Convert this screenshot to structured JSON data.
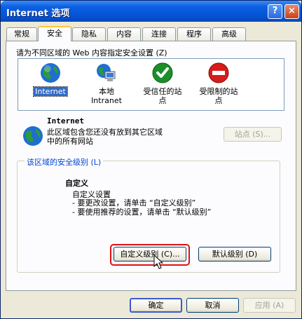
{
  "window": {
    "title": "Internet 选项",
    "help_glyph": "?",
    "close_glyph": "×"
  },
  "tabs": [
    {
      "label": "常规",
      "active": false
    },
    {
      "label": "安全",
      "active": true
    },
    {
      "label": "隐私",
      "active": false
    },
    {
      "label": "内容",
      "active": false
    },
    {
      "label": "连接",
      "active": false
    },
    {
      "label": "程序",
      "active": false
    },
    {
      "label": "高级",
      "active": false
    }
  ],
  "security": {
    "zone_prompt": "请为不同区域的 Web 内容指定安全设置 (Z)",
    "zones": [
      {
        "label": "Internet",
        "icon": "globe-icon",
        "selected": true
      },
      {
        "label": "本地\nIntranet",
        "icon": "local-intranet-icon",
        "selected": false
      },
      {
        "label": "受信任的站\n点",
        "icon": "trusted-sites-icon",
        "selected": false
      },
      {
        "label": "受限制的站\n点",
        "icon": "restricted-sites-icon",
        "selected": false
      }
    ],
    "selected_zone": {
      "name": "Internet",
      "description_line1": "此区域包含您还没有放到其它区域",
      "description_line2": "中的所有网站",
      "sites_button": "站点 (S)..."
    },
    "level_group": {
      "title": "该区域的安全级别 (L)",
      "level_name": "自定义",
      "lines": [
        "自定义设置",
        "- 要更改设置，请单击 “自定义级别”",
        "- 要使用推荐的设置，请单击 “默认级别”"
      ],
      "custom_level_button": "自定义级别 (C)...",
      "default_level_button": "默认级别 (D)"
    }
  },
  "footer": {
    "ok": "确定",
    "cancel": "取消",
    "apply": "应用 (A)"
  },
  "colors": {
    "titlebar": "#0454d6",
    "selection": "#316ac5",
    "highlight_box": "#e01010",
    "group_title": "#0046d5"
  }
}
